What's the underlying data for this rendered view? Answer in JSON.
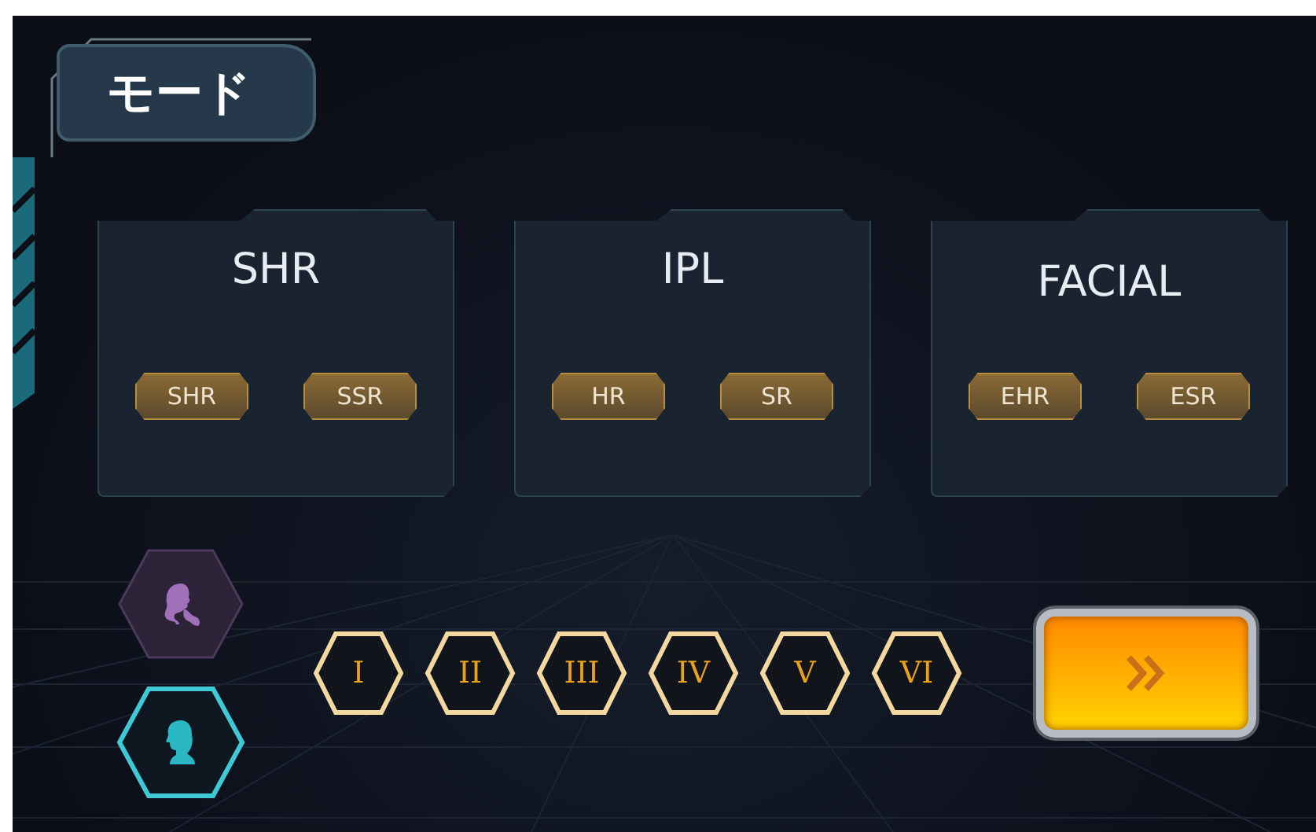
{
  "title": "モード",
  "cards": [
    {
      "title": "SHR",
      "modes": [
        {
          "label": "SHR"
        },
        {
          "label": "SSR"
        }
      ]
    },
    {
      "title": "IPL",
      "modes": [
        {
          "label": "HR"
        },
        {
          "label": "SR"
        }
      ]
    },
    {
      "title": "FACIAL",
      "modes": [
        {
          "label": "EHR"
        },
        {
          "label": "ESR"
        }
      ]
    }
  ],
  "genders": [
    {
      "kind": "female",
      "selected": false
    },
    {
      "kind": "male",
      "selected": true
    }
  ],
  "skin_types": [
    {
      "label": "I"
    },
    {
      "label": "II"
    },
    {
      "label": "III"
    },
    {
      "label": "IV"
    },
    {
      "label": "V"
    },
    {
      "label": "VI"
    }
  ]
}
